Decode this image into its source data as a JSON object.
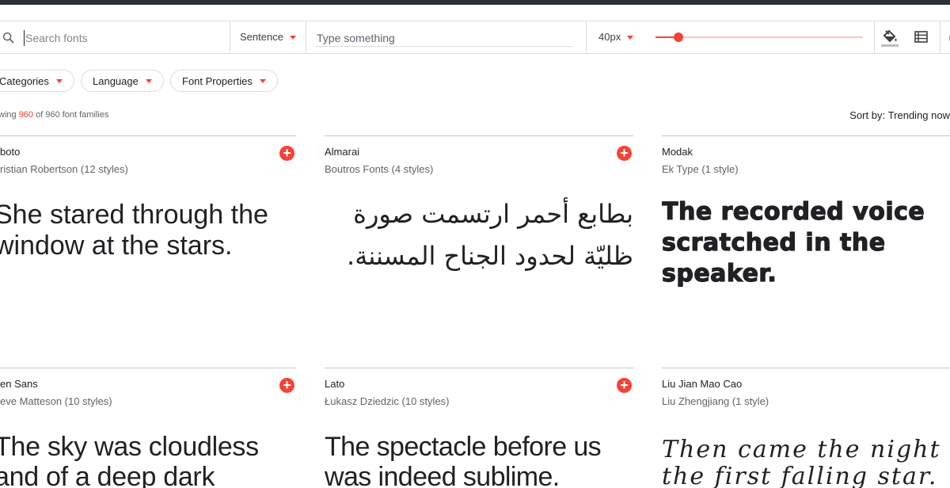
{
  "search": {
    "placeholder": "Search fonts"
  },
  "preview_mode": {
    "label": "Sentence"
  },
  "type_input": {
    "placeholder": "Type something"
  },
  "size": {
    "label": "40px",
    "slider_fraction": 0.11
  },
  "icons": [
    "search-icon",
    "paint-bucket-icon",
    "list-view-icon",
    "refresh-icon"
  ],
  "filters": [
    "Categories",
    "Language",
    "Font Properties"
  ],
  "count": {
    "prefix": "wing ",
    "shown": "960",
    "suffix": " of 960 font families"
  },
  "sort": {
    "label": "Sort by: ",
    "value": "Trending now"
  },
  "cards": [
    {
      "name": "boto",
      "author": "ristian Robertson (12 styles)",
      "sample": "She stared through the window at the stars."
    },
    {
      "name": "Almarai",
      "author": "Boutros Fonts (4 styles)",
      "sample": "بطابع أحمر ارتسمت صورة ظليّة لحدود الجناح المسننة."
    },
    {
      "name": "Modak",
      "author": "Ek Type (1 style)",
      "sample": "The recorded voice scratched in the speaker."
    },
    {
      "name": "en Sans",
      "author": "eve Matteson (10 styles)",
      "sample": "The sky was cloudless and of a deep dark"
    },
    {
      "name": "Lato",
      "author": "Łukasz Dziedzic (10 styles)",
      "sample": "The spectacle before us was indeed sublime."
    },
    {
      "name": "Liu Jian Mao Cao",
      "author": "Liu Zhengjiang (1 style)",
      "sample": "Then came the night of the first falling star."
    }
  ],
  "colors": {
    "accent": "#f44336",
    "top_bar": "#263238",
    "divider": "#dadce0"
  }
}
